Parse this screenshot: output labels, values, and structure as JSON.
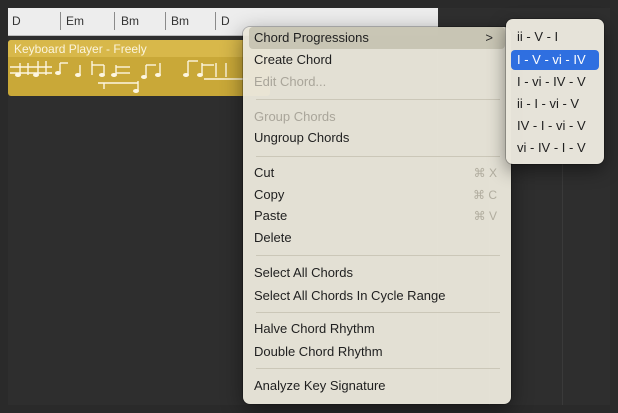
{
  "chord_track": {
    "chords": [
      "D",
      "Em",
      "Bm",
      "Bm",
      "D"
    ]
  },
  "region": {
    "name": "Keyboard Player - Freely",
    "color": "#c9a838"
  },
  "context_menu": {
    "items": [
      {
        "label": "Chord Progressions",
        "state": "highlighted",
        "has_submenu": true,
        "shortcut": ""
      },
      {
        "label": "Create Chord",
        "state": "enabled",
        "shortcut": ""
      },
      {
        "label": "Edit Chord...",
        "state": "disabled",
        "shortcut": ""
      },
      {
        "label": "Group Chords",
        "state": "disabled",
        "shortcut": ""
      },
      {
        "label": "Ungroup Chords",
        "state": "enabled",
        "shortcut": ""
      },
      {
        "label": "Cut",
        "state": "enabled",
        "shortcut": "⌘ X"
      },
      {
        "label": "Copy",
        "state": "enabled",
        "shortcut": "⌘ C"
      },
      {
        "label": "Paste",
        "state": "enabled",
        "shortcut": "⌘ V"
      },
      {
        "label": "Delete",
        "state": "enabled",
        "shortcut": ""
      },
      {
        "label": "Select All Chords",
        "state": "enabled",
        "shortcut": ""
      },
      {
        "label": "Select All Chords In Cycle Range",
        "state": "enabled",
        "shortcut": ""
      },
      {
        "label": "Halve Chord Rhythm",
        "state": "enabled",
        "shortcut": ""
      },
      {
        "label": "Double Chord Rhythm",
        "state": "enabled",
        "shortcut": ""
      },
      {
        "label": "Analyze Key Signature",
        "state": "enabled",
        "shortcut": ""
      }
    ],
    "submenu_chevron": ">"
  },
  "submenu": {
    "items": [
      {
        "label": "ii - V - I",
        "selected": false
      },
      {
        "label": "I - V - vi - IV",
        "selected": true
      },
      {
        "label": "I - vi - IV - V",
        "selected": false
      },
      {
        "label": "ii - I - vi - V",
        "selected": false
      },
      {
        "label": "IV - I - vi - V",
        "selected": false
      },
      {
        "label": "vi - IV - I - V",
        "selected": false
      }
    ],
    "selected_color": "#2f6fe0"
  }
}
